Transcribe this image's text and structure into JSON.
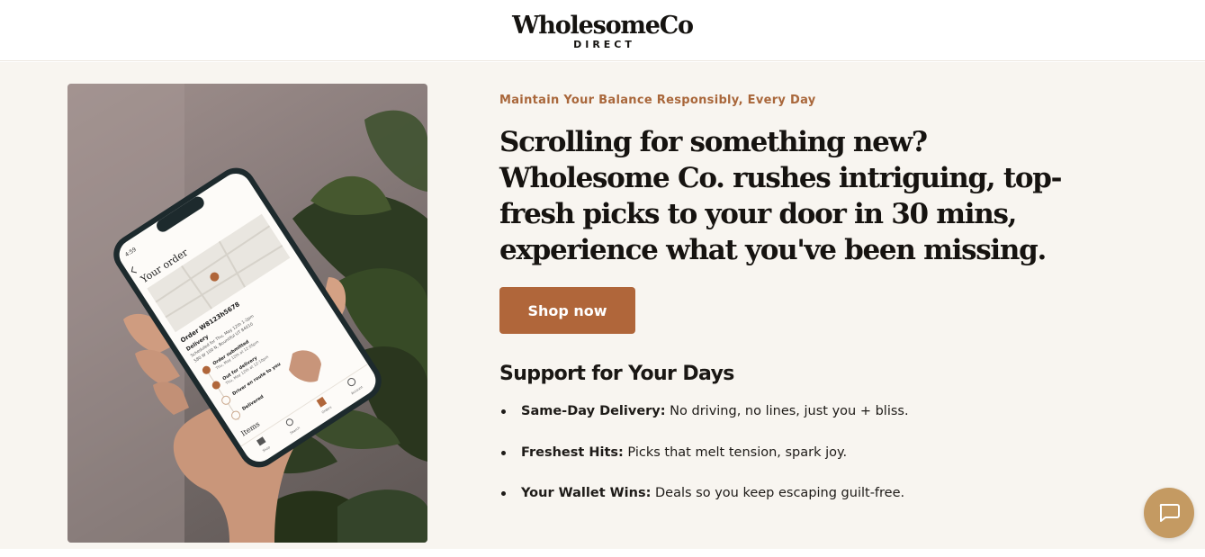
{
  "brand": {
    "name": "WholesomeCo",
    "sub": "DIRECT"
  },
  "hero": {
    "eyebrow": "Maintain Your Balance Responsibly, Every Day",
    "headline": "Scrolling for something new? Wholesome Co. rushes intriguing, top-fresh picks to your door in 30 mins, experience what you've been missing.",
    "cta_label": "Shop now"
  },
  "support": {
    "title": "Support for Your Days",
    "items": [
      {
        "label": "Same-Day Delivery:",
        "text": " No driving, no lines, just you + bliss."
      },
      {
        "label": "Freshest Hits:",
        "text": " Picks that melt tension, spark joy."
      },
      {
        "label": "Your Wallet Wins:",
        "text": " Deals so you keep escaping guilt-free."
      }
    ]
  },
  "phone_screen": {
    "time": "4:59",
    "title": "Your order",
    "order": "Order W8123h5678",
    "delivery": "Delivery",
    "scheduled": "Scheduled for Thu, May 12th 1-2pm",
    "address": "580 W 100 N, Bountiful UT 84010",
    "steps": [
      "Order submitted",
      "Out for delivery",
      "Driver en route to you",
      "Delivered"
    ],
    "step_details": [
      "Thu, May 12th at 12:05pm",
      "Thu, May 12th at 12:10pm",
      "",
      ""
    ],
    "items_label": "Items",
    "nav": [
      "Shop",
      "Search",
      "Orders",
      "Account"
    ]
  },
  "colors": {
    "accent": "#b0663a",
    "eyebrow": "#a9673b",
    "background": "#f8f5f0",
    "chat": "#c49a62"
  },
  "icons": [
    "chat-icon",
    "back-arrow-icon",
    "shop-icon",
    "search-icon",
    "orders-icon",
    "account-icon",
    "map-pin-icon"
  ]
}
